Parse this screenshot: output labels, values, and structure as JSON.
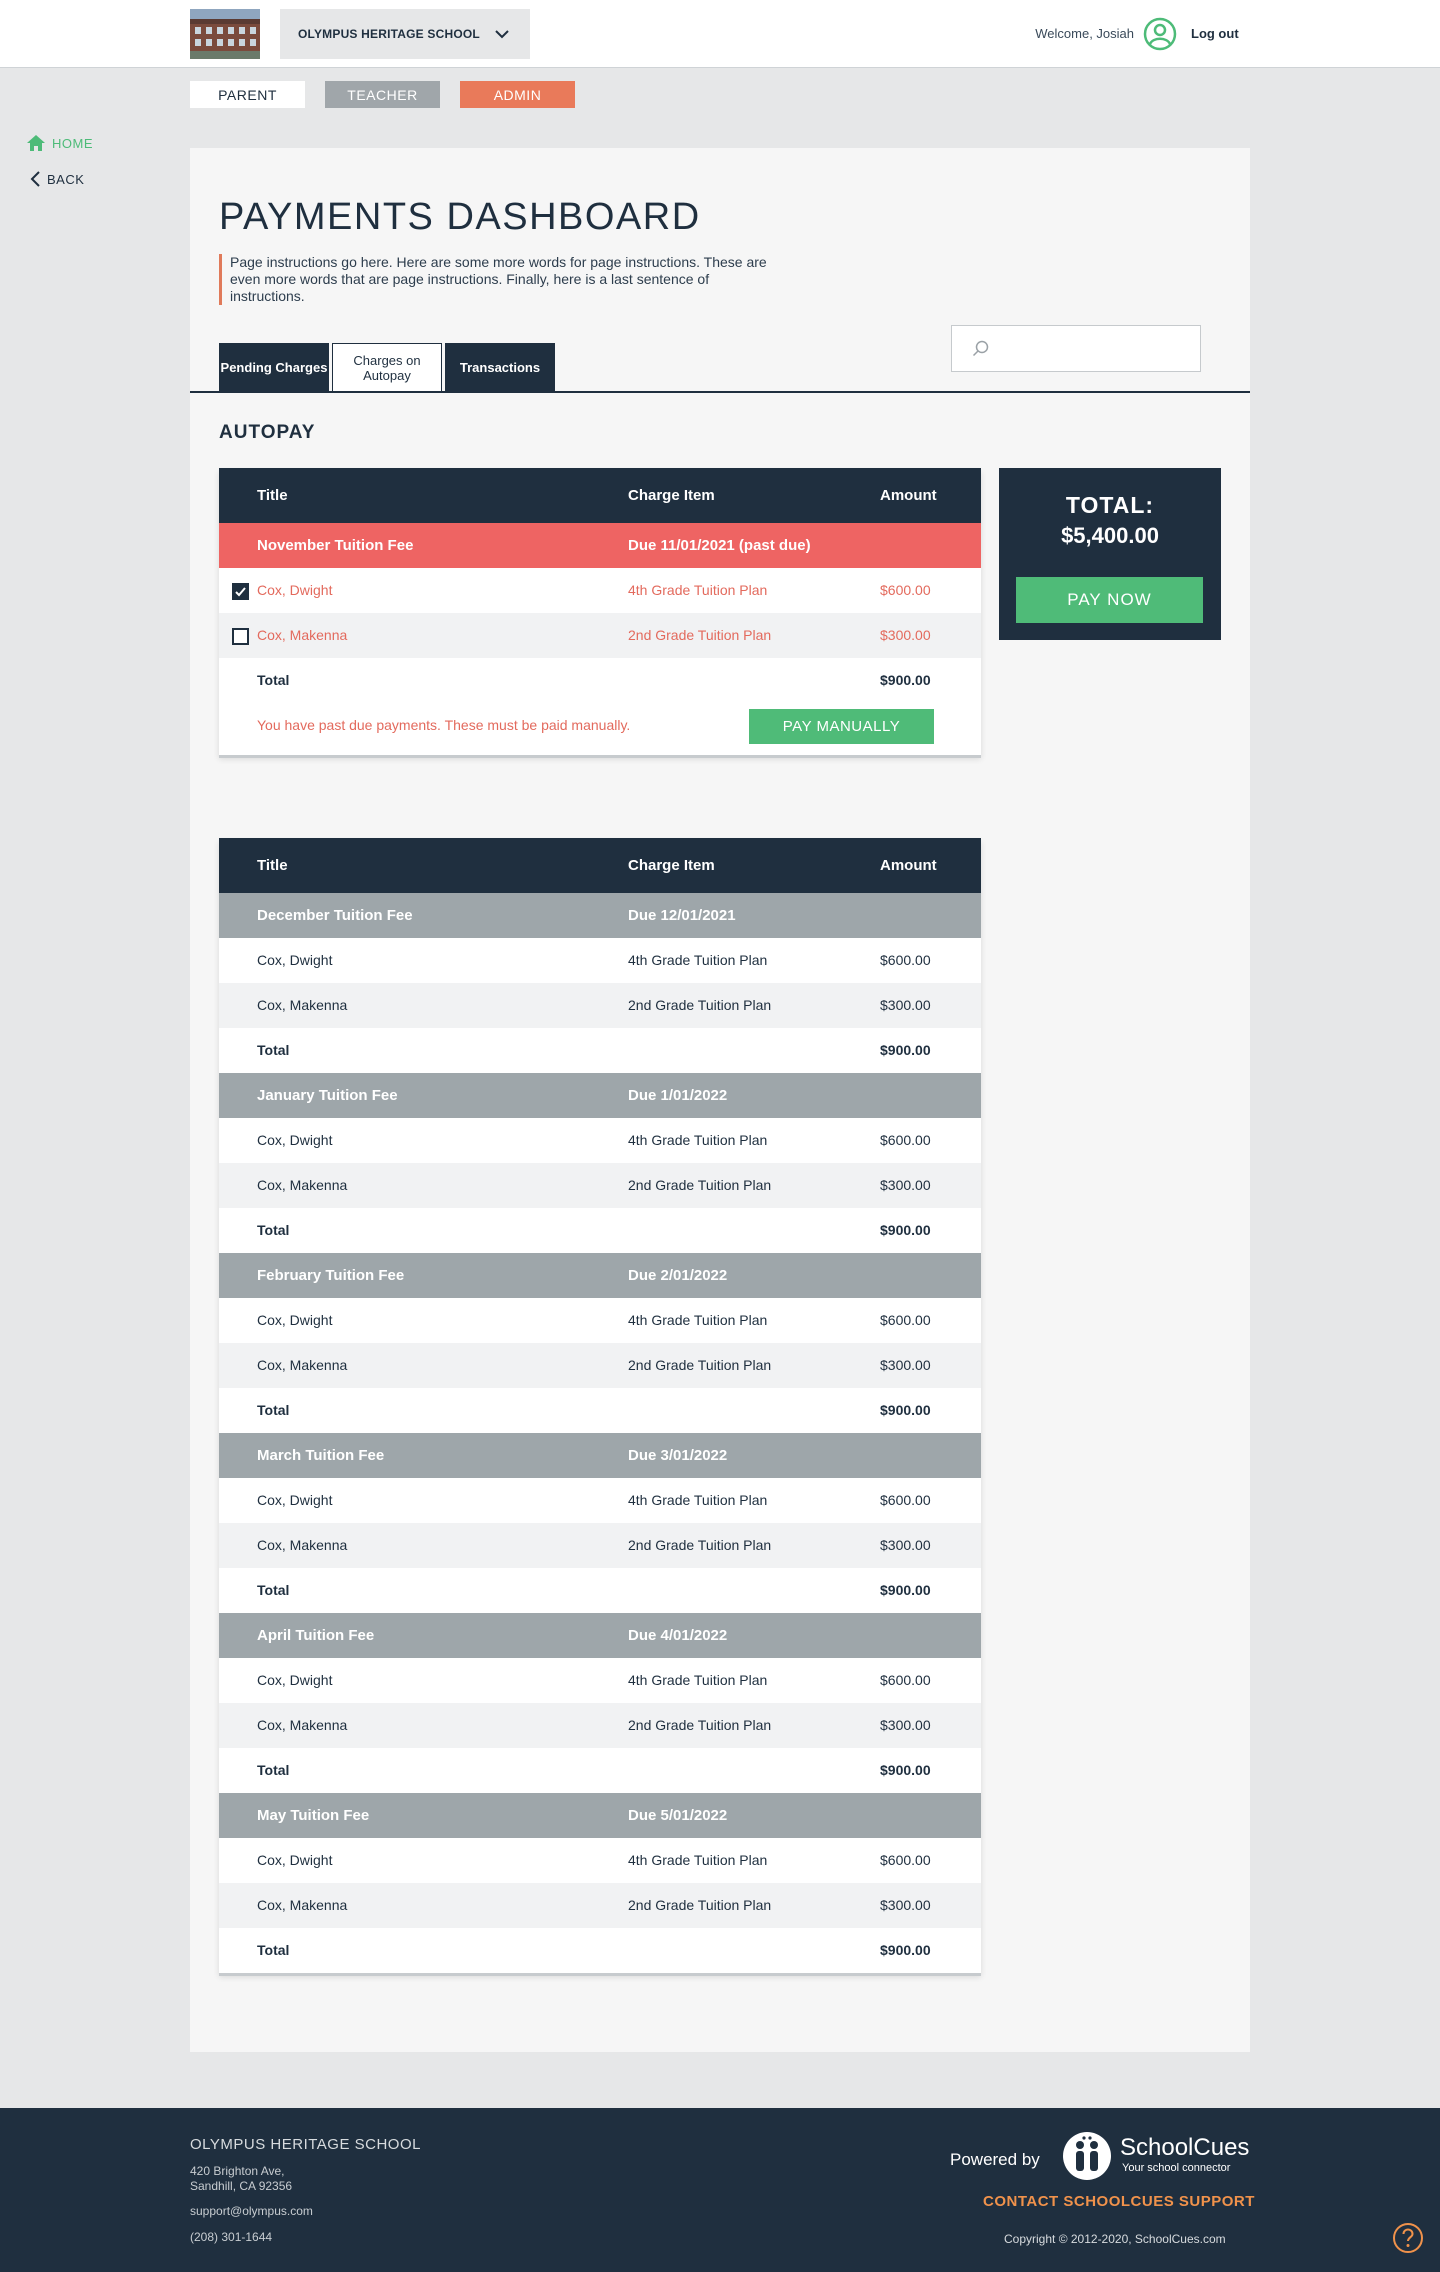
{
  "header": {
    "school_name": "OLYMPUS HERITAGE SCHOOL",
    "welcome": "Welcome, Josiah",
    "logout": "Log out"
  },
  "roles": [
    "PARENT",
    "TEACHER",
    "ADMIN"
  ],
  "sidenav": {
    "home": "HOME",
    "back": "BACK"
  },
  "page": {
    "title": "PAYMENTS DASHBOARD",
    "instructions": "Page instructions go here. Here are some more words for page instructions. These are even more words that are page instructions. Finally, here is a last sentence of instructions.",
    "tabs": [
      "Pending Charges",
      "Charges on Autopay",
      "Transactions"
    ],
    "active_tab": "Charges on Autopay",
    "search_placeholder": "",
    "section_title": "AUTOPAY"
  },
  "columns": {
    "title": "Title",
    "charge_item": "Charge Item",
    "amount": "Amount"
  },
  "past_due_table": {
    "group": {
      "title": "November Tuition Fee",
      "due": "Due 11/01/2021 (past due)"
    },
    "rows": [
      {
        "name": "Cox, Dwight",
        "item": "4th Grade Tuition Plan",
        "amount": "$600.00",
        "checked": true
      },
      {
        "name": "Cox, Makenna",
        "item": "2nd Grade Tuition Plan",
        "amount": "$300.00",
        "checked": false
      }
    ],
    "total_label": "Total",
    "total": "$900.00",
    "warning": "You have past due payments. These must be paid manually.",
    "pay_manually": "PAY MANUALLY"
  },
  "summary": {
    "label": "TOTAL:",
    "amount": "$5,400.00",
    "pay_now": "PAY NOW"
  },
  "upcoming": [
    {
      "title": "December Tuition Fee",
      "due": "Due 12/01/2021",
      "rows": [
        {
          "name": "Cox, Dwight",
          "item": "4th Grade Tuition Plan",
          "amount": "$600.00"
        },
        {
          "name": "Cox, Makenna",
          "item": "2nd Grade Tuition Plan",
          "amount": "$300.00"
        }
      ],
      "total_label": "Total",
      "total": "$900.00"
    },
    {
      "title": "January Tuition Fee",
      "due": "Due 1/01/2022",
      "rows": [
        {
          "name": "Cox, Dwight",
          "item": "4th Grade Tuition Plan",
          "amount": "$600.00"
        },
        {
          "name": "Cox, Makenna",
          "item": "2nd Grade Tuition Plan",
          "amount": "$300.00"
        }
      ],
      "total_label": "Total",
      "total": "$900.00"
    },
    {
      "title": "February Tuition Fee",
      "due": "Due 2/01/2022",
      "rows": [
        {
          "name": "Cox, Dwight",
          "item": "4th Grade Tuition Plan",
          "amount": "$600.00"
        },
        {
          "name": "Cox, Makenna",
          "item": "2nd Grade Tuition Plan",
          "amount": "$300.00"
        }
      ],
      "total_label": "Total",
      "total": "$900.00"
    },
    {
      "title": "March Tuition Fee",
      "due": "Due 3/01/2022",
      "rows": [
        {
          "name": "Cox, Dwight",
          "item": "4th Grade Tuition Plan",
          "amount": "$600.00"
        },
        {
          "name": "Cox, Makenna",
          "item": "2nd Grade Tuition Plan",
          "amount": "$300.00"
        }
      ],
      "total_label": "Total",
      "total": "$900.00"
    },
    {
      "title": "April Tuition Fee",
      "due": "Due 4/01/2022",
      "rows": [
        {
          "name": "Cox, Dwight",
          "item": "4th Grade Tuition Plan",
          "amount": "$600.00"
        },
        {
          "name": "Cox, Makenna",
          "item": "2nd Grade Tuition Plan",
          "amount": "$300.00"
        }
      ],
      "total_label": "Total",
      "total": "$900.00"
    },
    {
      "title": "May Tuition Fee",
      "due": "Due 5/01/2022",
      "rows": [
        {
          "name": "Cox, Dwight",
          "item": "4th Grade Tuition Plan",
          "amount": "$600.00"
        },
        {
          "name": "Cox, Makenna",
          "item": "2nd Grade Tuition Plan",
          "amount": "$300.00"
        }
      ],
      "total_label": "Total",
      "total": "$900.00"
    }
  ],
  "footer": {
    "school": "OLYMPUS HERITAGE SCHOOL",
    "address_line1": "420 Brighton Ave,",
    "address_line2": "Sandhill, CA 92356",
    "email": "support@olympus.com",
    "phone": "(208) 301-1644",
    "powered_by": "Powered by",
    "brand": "SchoolCues",
    "tagline": "Your school connector",
    "support_link": "CONTACT SCHOOLCUES SUPPORT",
    "copyright": "Copyright © 2012-2020, SchoolCues.com"
  },
  "colors": {
    "navy": "#1f2f3f",
    "green": "#4fbb78",
    "past_due_red": "#ee6463",
    "admin_orange": "#e97a5a",
    "group_gray": "#9ea6aa",
    "support_orange": "#f0924b"
  }
}
